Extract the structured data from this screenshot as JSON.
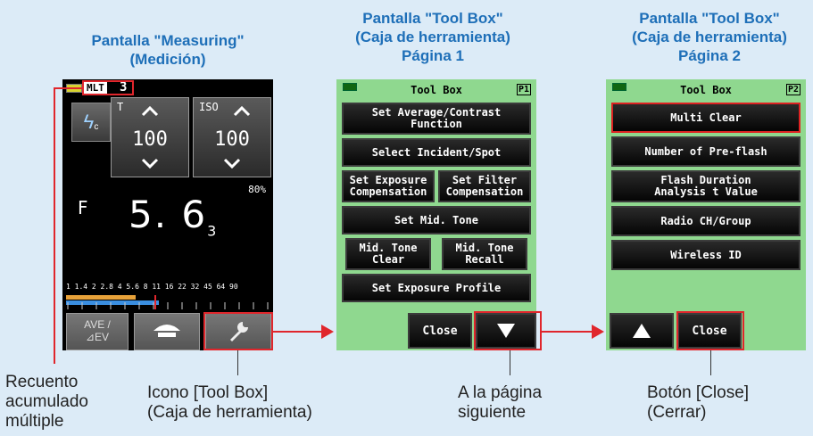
{
  "titles": {
    "measuring": [
      "Pantalla \"Measuring\"",
      "(Medición)"
    ],
    "toolbox1": [
      "Pantalla \"Tool Box\"",
      "(Caja de herramienta)",
      "Página 1"
    ],
    "toolbox2": [
      "Pantalla \"Tool Box\"",
      "(Caja de herramienta)",
      "Página 2"
    ]
  },
  "measuring": {
    "mlt_badge": "MLT",
    "mlt_count": "3",
    "t_label": "T",
    "t_value": "100",
    "iso_label": "ISO",
    "iso_value": "100",
    "percent": "80%",
    "f_label": "F",
    "f_value": "5. 6",
    "f_sub": "3",
    "scale": "1  1.4  2  2.8  4  5.6  8  11  16  22  32  45  64  90",
    "ave_label": "AVE /",
    "ev_label": "⊿EV"
  },
  "toolbox1": {
    "header": "Tool Box",
    "page": "P1",
    "buttons": {
      "avg_contrast": "Set Average/Contrast\nFunction",
      "incident_spot": "Select Incident/Spot",
      "exposure_comp": "Set Exposure\nCompensation",
      "filter_comp": "Set Filter\nCompensation",
      "mid_tone": "Set Mid. Tone",
      "mid_tone_clear": "Mid. Tone\nClear",
      "mid_tone_recall": "Mid. Tone\nRecall",
      "exposure_profile": "Set Exposure Profile",
      "close": "Close"
    }
  },
  "toolbox2": {
    "header": "Tool Box",
    "page": "P2",
    "buttons": {
      "multi_clear": "Multi Clear",
      "pre_flash": "Number of Pre-flash",
      "flash_duration": "Flash Duration\nAnalysis t Value",
      "radio_ch": "Radio CH/Group",
      "wireless_id": "Wireless ID",
      "close": "Close"
    }
  },
  "captions": {
    "multi_count": [
      "Recuento",
      "acumulado",
      "múltiple"
    ],
    "toolbox_icon": [
      "Icono [Tool Box]",
      "(Caja de herramienta)"
    ],
    "next_page": [
      "A la página",
      "siguiente"
    ],
    "close_button": [
      "Botón [Close]",
      "(Cerrar)"
    ]
  },
  "colors": {
    "accent_red": "#e0262c",
    "title_blue": "#1e6fb8",
    "panel_green": "#8fd88f"
  }
}
